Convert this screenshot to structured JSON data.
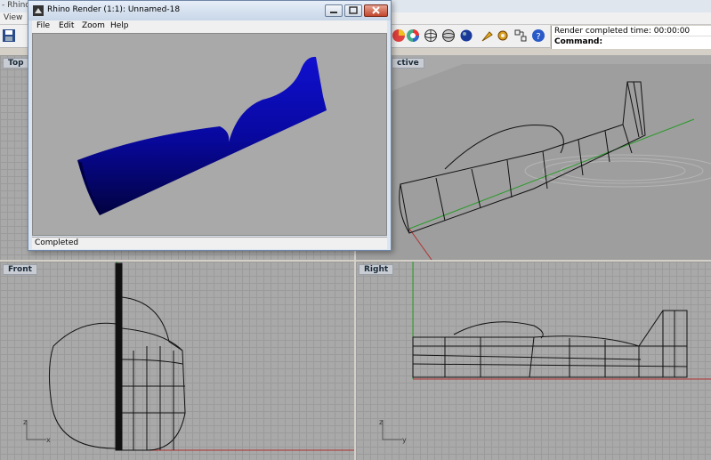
{
  "app": {
    "title": "- Rhino",
    "menu_view": "View"
  },
  "command": {
    "history_line": "Render completed time: 00:00:00",
    "prompt": "Command:"
  },
  "viewports": {
    "top": {
      "label": "Top"
    },
    "perspective": {
      "label": "ctive"
    },
    "front": {
      "label": "Front",
      "axis_x": "x",
      "axis_z": "z"
    },
    "right": {
      "label": "Right",
      "axis_y": "y",
      "axis_z": "z"
    }
  },
  "render_window": {
    "title": "Rhino Render (1:1): Unnamed-18",
    "menus": [
      "File",
      "Edit",
      "Zoom",
      "Help"
    ],
    "status": "Completed"
  }
}
